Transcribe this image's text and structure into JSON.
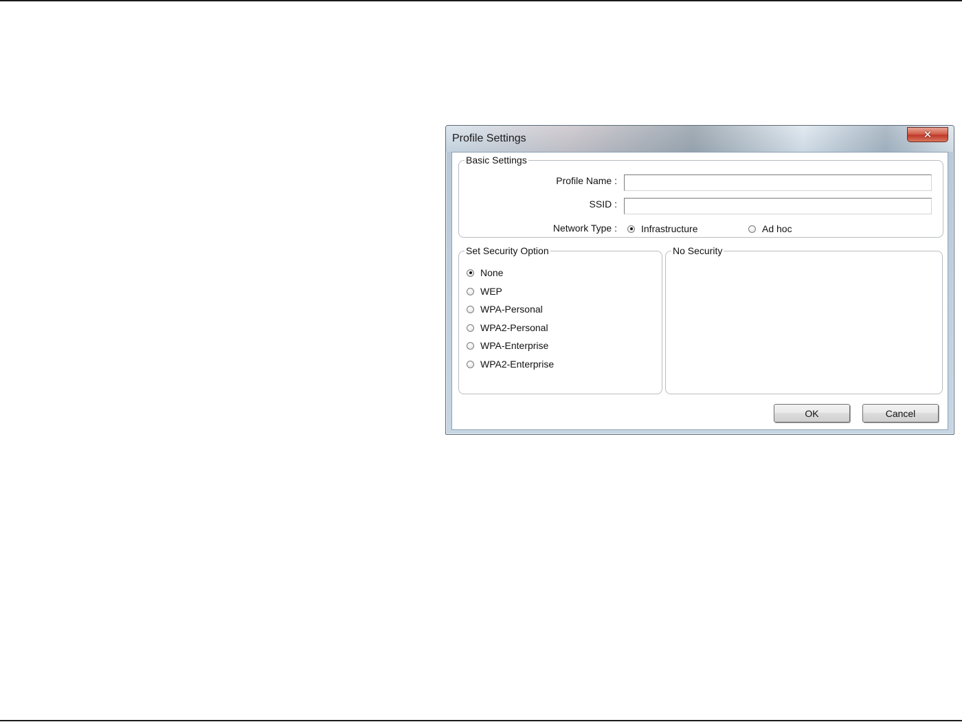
{
  "window": {
    "title": "Profile Settings",
    "close_glyph": "✕"
  },
  "basic_settings": {
    "legend": "Basic Settings",
    "profile_name_label": "Profile Name :",
    "profile_name_value": "",
    "ssid_label": "SSID :",
    "ssid_value": "",
    "network_type_label": "Network Type :",
    "network_types": [
      {
        "label": "Infrastructure",
        "selected": true
      },
      {
        "label": "Ad hoc",
        "selected": false
      }
    ]
  },
  "security": {
    "legend": "Set Security Option",
    "options": [
      {
        "label": "None",
        "selected": true
      },
      {
        "label": "WEP",
        "selected": false
      },
      {
        "label": "WPA-Personal",
        "selected": false
      },
      {
        "label": "WPA2-Personal",
        "selected": false
      },
      {
        "label": "WPA-Enterprise",
        "selected": false
      },
      {
        "label": "WPA2-Enterprise",
        "selected": false
      }
    ]
  },
  "security_detail": {
    "legend": "No Security"
  },
  "buttons": {
    "ok_label": "OK",
    "cancel_label": "Cancel"
  }
}
